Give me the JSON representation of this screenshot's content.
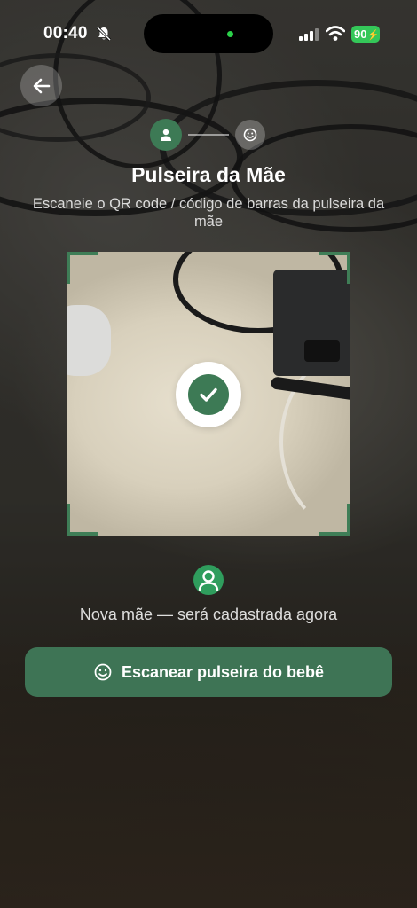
{
  "status_bar": {
    "time": "00:40",
    "battery": "90",
    "icons": [
      "bell-slash-icon",
      "signal-icon",
      "wifi-icon",
      "battery-charging-icon"
    ]
  },
  "header": {
    "back_icon": "arrow-left-icon",
    "step_icons": [
      "person-icon",
      "smiley-icon"
    ],
    "title": "Pulseira da Mãe",
    "subtitle": "Escaneie o QR code / código de barras da pulseira da mãe"
  },
  "scanner": {
    "status_icon": "checkmark-icon"
  },
  "result": {
    "avatar_icon": "person-circle-icon",
    "text": "Nova mãe — será cadastrada agora"
  },
  "action": {
    "button_icon": "smiley-icon",
    "button_label": "Escanear pulseira do bebê"
  },
  "colors": {
    "accent_green": "#3d7a55",
    "button_green": "#3e7455",
    "avatar_green": "#2f9d5d",
    "battery_green": "#34c759"
  }
}
